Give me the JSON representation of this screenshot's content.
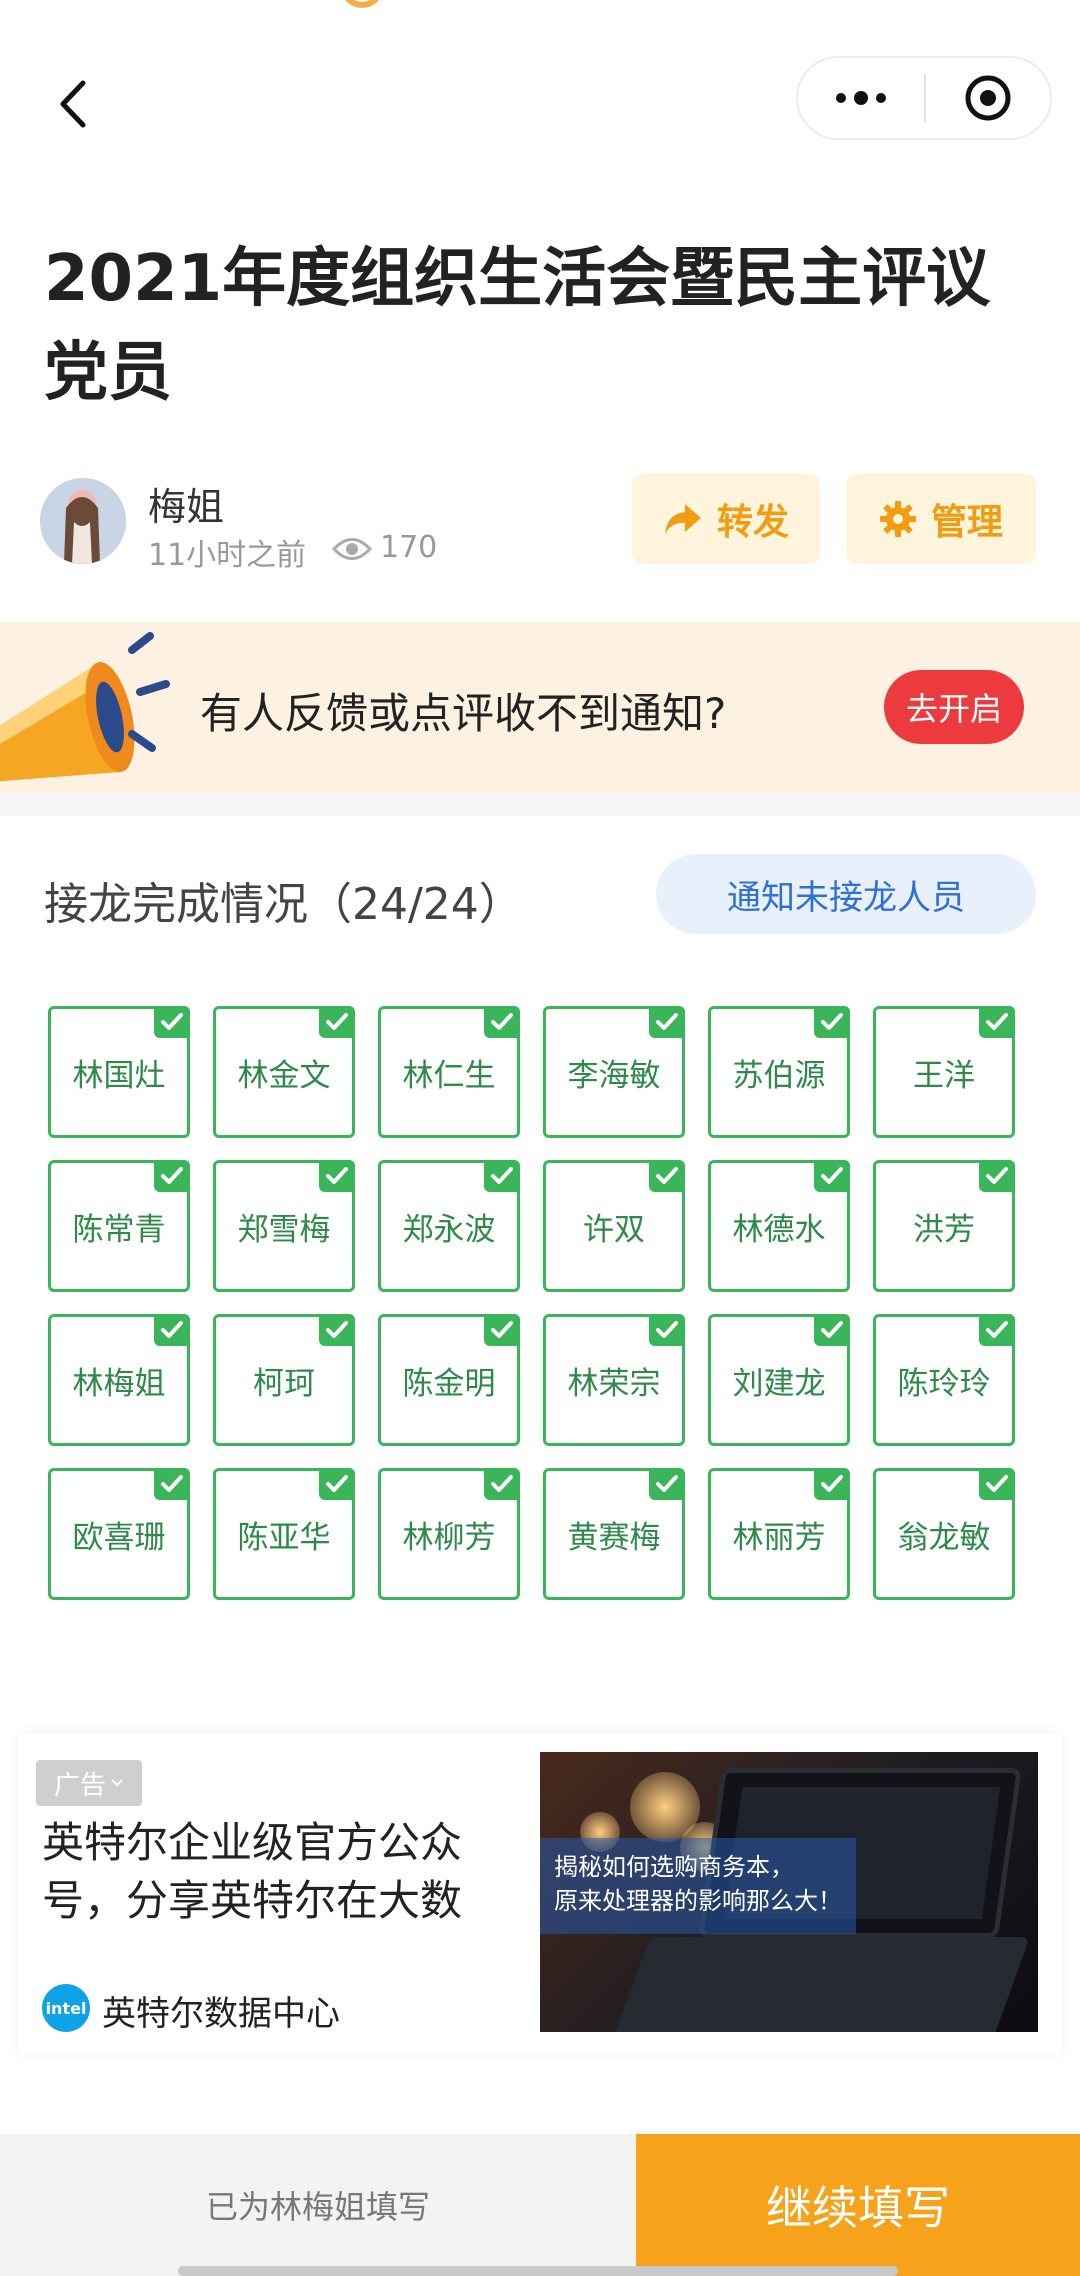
{
  "nav": {
    "back_icon": "chevron-left-icon",
    "more_icon": "more-dots-icon",
    "target_icon": "target-icon"
  },
  "article": {
    "title": "2021年度组织生活会暨民主评议党员",
    "author": "梅姐",
    "time": "11小时之前",
    "views": "170",
    "share_label": "转发",
    "manage_label": "管理"
  },
  "banner": {
    "text": "有人反馈或点评收不到通知?",
    "button": "去开启"
  },
  "progress": {
    "title": "接龙完成情况（24/24）",
    "notify_button": "通知未接龙人员",
    "names": [
      "林国灶",
      "林金文",
      "林仁生",
      "李海敏",
      "苏伯源",
      "王洋",
      "陈常青",
      "郑雪梅",
      "郑永波",
      "许双",
      "林德水",
      "洪芳",
      "林梅姐",
      "柯珂",
      "陈金明",
      "林荣宗",
      "刘建龙",
      "陈玲玲",
      "欧喜珊",
      "陈亚华",
      "林柳芳",
      "黄赛梅",
      "林丽芳",
      "翁龙敏"
    ]
  },
  "ad": {
    "tag": "广告",
    "text": "英特尔企业级官方公众号，分享英特尔在大数",
    "brand": "英特尔数据中心",
    "logo_text": "intel",
    "image_caption_line1": "揭秘如何选购商务本，",
    "image_caption_line2": "原来处理器的影响那么大！"
  },
  "bottom": {
    "left_text": "已为林梅姐填写",
    "right_button": "继续填写"
  },
  "colors": {
    "accent": "#f7a21b",
    "green": "#3bb55a",
    "red": "#ec3a3f",
    "blue": "#2f6fd6"
  }
}
